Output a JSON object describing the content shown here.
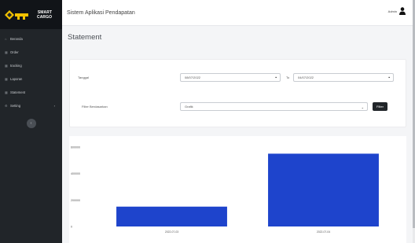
{
  "brand": {
    "line1": "SMART",
    "line2": "CARGO"
  },
  "sidebar": {
    "items": [
      {
        "label": "Beranda",
        "icon": "home-icon"
      },
      {
        "label": "Order",
        "icon": "table-icon"
      },
      {
        "label": "tracking",
        "icon": "table-icon"
      },
      {
        "label": "Laporan",
        "icon": "table-icon"
      },
      {
        "label": "Statement",
        "icon": "table-icon"
      },
      {
        "label": "Setting",
        "icon": "gear-icon",
        "chevron": "›"
      }
    ],
    "toggle_glyph": "‹"
  },
  "topbar": {
    "title": "Sistem Aplikasi Pendapatan",
    "user_name": "Admin"
  },
  "page": {
    "title": "Statement"
  },
  "filters": {
    "tanggal_label": "Tanggal",
    "date_from": "08/07/2022",
    "to_label": "To",
    "date_to": "04/07/2022",
    "filter_label": "Filter Berdasarkan",
    "filter_value": "Grafik",
    "filter_button": "Filter"
  },
  "colors": {
    "sidebar": "#212529",
    "bar": "#1e44cc",
    "button": "#212529"
  },
  "chart_data": {
    "type": "bar",
    "categories": [
      "2022-07-03",
      "2022-07-04"
    ],
    "values": [
      150000,
      550000
    ],
    "ylim": [
      0,
      600000
    ],
    "yticks": [
      0,
      200000,
      400000,
      600000
    ],
    "ytick_labels": [
      "0",
      "200000",
      "400000",
      "600000"
    ],
    "title": "",
    "xlabel": "",
    "ylabel": ""
  }
}
